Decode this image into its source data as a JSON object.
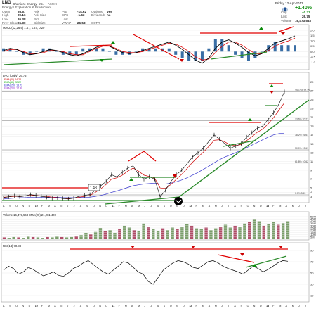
{
  "header": {
    "symbol": "LNG",
    "company": "Cheniere Energy, Inc.",
    "exchange": "AMEX",
    "sector": "Energy / Exploration & Production",
    "quote_rows": [
      {
        "l1": "Open",
        "v1": "26.57",
        "l2": "Ask",
        "v2": "",
        "l3": "P/E",
        "v3": "-14.62",
        "l4": "Options",
        "v4": "yes"
      },
      {
        "l1": "High",
        "v1": "29.16",
        "l2": "Ask Size",
        "v2": "",
        "l3": "EPS",
        "v3": "-1.63",
        "l4": "Dividends",
        "v4": "no"
      },
      {
        "l1": "Low",
        "v1": "26.38",
        "l2": "Bid",
        "v2": "",
        "l3": "Last",
        "v3": "",
        "l4": "",
        "v4": ""
      },
      {
        "l1": "Prev Close",
        "v1": "26.30",
        "l2": "Bid Size",
        "v2": "",
        "l3": "VWAP",
        "v3": "26.58",
        "l4": "SCTR",
        "v4": ""
      }
    ],
    "date": "Friday 12-Apr-2013",
    "change_pct": "+1.40%",
    "change_label": "Chg",
    "change": "+0.37",
    "last_label": "Last",
    "last": "26.75",
    "volume_label": "Volume",
    "volume": "16,473,563",
    "brand": "StockCharts.com"
  },
  "colors": {
    "up": "#0a8a0a",
    "down": "#cc0000",
    "green_line": "#2a8a2a",
    "red_line": "#e00000",
    "macd": "#000000",
    "signal": "#dd0000",
    "hist": "#3a6ea5",
    "price": "#000000",
    "ema1": "#cc0000",
    "ema2": "#00aa00",
    "ema3": "#3333cc",
    "ema4": "#9933cc",
    "rsi": "#000000",
    "vol_up": "#7a9e6a",
    "vol_down": "#b04a66",
    "volma": "#aa0000"
  },
  "chart_data": [
    {
      "type": "line",
      "panel": "MACD",
      "title": "MACD(12,26,9) 1.47, 1.27, 0.20",
      "series": [
        {
          "name": "MACD",
          "values": [
            0.1,
            0.3,
            0.2,
            -0.1,
            -0.3,
            -0.2,
            0.0,
            0.2,
            0.1,
            -0.1,
            -0.3,
            -0.4,
            -0.2,
            0.1,
            0.4,
            0.6,
            0.5,
            0.2,
            -0.1,
            -0.2,
            -0.1,
            0.1,
            0.3,
            0.5,
            0.7,
            0.9,
            0.6,
            0.2,
            -0.3,
            -0.8,
            -1.1,
            -0.6,
            0.3,
            0.9,
            1.1,
            0.8,
            0.4,
            -0.1,
            -0.4,
            -0.2,
            0.3,
            0.8,
            1.0,
            1.2,
            1.47
          ]
        },
        {
          "name": "Signal",
          "values": [
            0.0,
            0.2,
            0.2,
            0.0,
            -0.2,
            -0.2,
            -0.1,
            0.1,
            0.1,
            0.0,
            -0.2,
            -0.3,
            -0.3,
            0.0,
            0.3,
            0.5,
            0.5,
            0.3,
            0.0,
            -0.1,
            -0.1,
            0.0,
            0.2,
            0.4,
            0.6,
            0.8,
            0.7,
            0.4,
            0.0,
            -0.5,
            -0.8,
            -0.7,
            -0.1,
            0.5,
            0.9,
            0.9,
            0.6,
            0.2,
            -0.2,
            -0.2,
            0.1,
            0.5,
            0.8,
            1.0,
            1.27
          ]
        }
      ],
      "ylim": [
        -1.5,
        2.0
      ],
      "y_ticks": [
        "2.0",
        "1.5",
        "1.0",
        "0.5",
        "0.0",
        "-0.5",
        "-1.0"
      ]
    },
    {
      "type": "line",
      "panel": "Price",
      "title": "LNG (Daily) 26.75",
      "legend": [
        "EMA(20) 24.24",
        "EMA(50) 22.22",
        "EMA(150) 18.72",
        "EMA(200) 17.40"
      ],
      "x_labels": [
        "A",
        "S",
        "O",
        "N",
        "D",
        "10",
        "F",
        "M",
        "A",
        "M",
        "J",
        "J",
        "A",
        "S",
        "O",
        "N",
        "D",
        "11",
        "F",
        "M",
        "A",
        "M",
        "J",
        "J",
        "A",
        "S",
        "O",
        "N",
        "D",
        "12",
        "F",
        "M",
        "A",
        "M",
        "J",
        "J",
        "A",
        "S",
        "O",
        "N",
        "D",
        "13",
        "F",
        "M",
        "A",
        "M",
        "J",
        "J"
      ],
      "close": [
        2.8,
        3.0,
        3.2,
        3.0,
        3.2,
        3.5,
        3.3,
        3.1,
        2.9,
        2.7,
        2.8,
        2.6,
        2.5,
        2.7,
        3.1,
        3.3,
        3.5,
        4.5,
        5.5,
        6.5,
        8.0,
        7.5,
        8.5,
        9.5,
        10.0,
        8.0,
        7.0,
        7.5,
        7.0,
        3.0,
        4.5,
        6.5,
        8.0,
        9.0,
        10.5,
        12.0,
        13.0,
        14.0,
        15.5,
        17.0,
        16.0,
        15.0,
        14.0,
        14.5,
        15.0,
        16.5,
        17.5,
        18.5,
        19.0,
        20.5,
        22.0,
        24.0,
        26.75
      ],
      "ema20": [
        2.9,
        3.0,
        3.1,
        3.1,
        3.2,
        3.3,
        3.3,
        3.2,
        3.1,
        2.9,
        2.8,
        2.7,
        2.6,
        2.7,
        2.9,
        3.1,
        3.3,
        4.0,
        4.8,
        5.8,
        7.0,
        7.3,
        7.9,
        8.8,
        9.5,
        8.8,
        7.9,
        7.6,
        7.2,
        5.0,
        4.9,
        5.8,
        7.0,
        8.1,
        9.4,
        10.8,
        12.0,
        13.1,
        14.4,
        15.8,
        15.9,
        15.4,
        14.7,
        14.6,
        14.8,
        15.7,
        16.6,
        17.6,
        18.3,
        19.5,
        20.9,
        22.6,
        24.24
      ],
      "ema200": [
        2.5,
        2.6,
        2.7,
        2.8,
        2.8,
        2.9,
        2.9,
        2.9,
        2.9,
        2.9,
        2.9,
        2.8,
        2.8,
        2.8,
        2.8,
        2.9,
        2.9,
        3.1,
        3.3,
        3.6,
        4.0,
        4.3,
        4.7,
        5.1,
        5.5,
        5.7,
        5.9,
        6.0,
        6.1,
        5.9,
        5.9,
        6.1,
        6.4,
        6.8,
        7.3,
        7.9,
        8.5,
        9.2,
        9.9,
        10.7,
        11.4,
        12.0,
        12.5,
        13.0,
        13.5,
        14.1,
        14.7,
        15.3,
        15.9,
        16.5,
        17.0,
        17.3,
        17.4
      ],
      "fib_levels": [
        {
          "label": "100.0% 26.75",
          "value": 26.75
        },
        {
          "label": "23.6% 20.21",
          "value": 20.21
        },
        {
          "label": "38.2% 16.61",
          "value": 16.61
        },
        {
          "label": "50.0% 13.61",
          "value": 13.61
        },
        {
          "label": "61.8% 10.62",
          "value": 10.62
        },
        {
          "label": "0.0% 3.43",
          "value": 3.43
        }
      ],
      "annotations": [
        "1.48"
      ],
      "ylim": [
        2,
        30
      ],
      "y_ticks": [
        "29",
        "27",
        "25",
        "23",
        "21",
        "19",
        "17",
        "15",
        "13",
        "11",
        "9",
        "7",
        "5",
        "4",
        "3"
      ]
    },
    {
      "type": "bar",
      "panel": "Volume",
      "title": "Volume 16,473,563  EMA(20) 21,281,400",
      "values": [
        4,
        3,
        5,
        4,
        3,
        6,
        5,
        4,
        3,
        5,
        4,
        6,
        5,
        4,
        5,
        7,
        9,
        14,
        12,
        16,
        25,
        18,
        20,
        14,
        22,
        30,
        26,
        20,
        18,
        35,
        28,
        22,
        18,
        24,
        20,
        26,
        22,
        28,
        34,
        30,
        24,
        22,
        26,
        20,
        24,
        28,
        32,
        26,
        30,
        28,
        35,
        38,
        45,
        40,
        30,
        34,
        38,
        32,
        36,
        40
      ],
      "ylim": [
        0,
        50
      ],
      "y_ticks": [
        "50M",
        "45M",
        "40M",
        "35M",
        "30M",
        "25M",
        "20M",
        "15M",
        "10M",
        "5M"
      ]
    },
    {
      "type": "line",
      "panel": "RSI",
      "title": "RSI(14) 70.88",
      "values": [
        55,
        62,
        58,
        48,
        52,
        60,
        56,
        50,
        45,
        48,
        52,
        46,
        44,
        50,
        58,
        62,
        68,
        72,
        65,
        58,
        52,
        48,
        55,
        62,
        70,
        68,
        60,
        52,
        48,
        35,
        30,
        42,
        55,
        62,
        68,
        72,
        70,
        66,
        60,
        58,
        64,
        70,
        72,
        68,
        62,
        58,
        55,
        52,
        48,
        55,
        62,
        58,
        52,
        56,
        62,
        68,
        72,
        70.88
      ],
      "ylim": [
        0,
        100
      ],
      "y_ticks": [
        "90",
        "70",
        "50",
        "30",
        "10"
      ]
    }
  ]
}
